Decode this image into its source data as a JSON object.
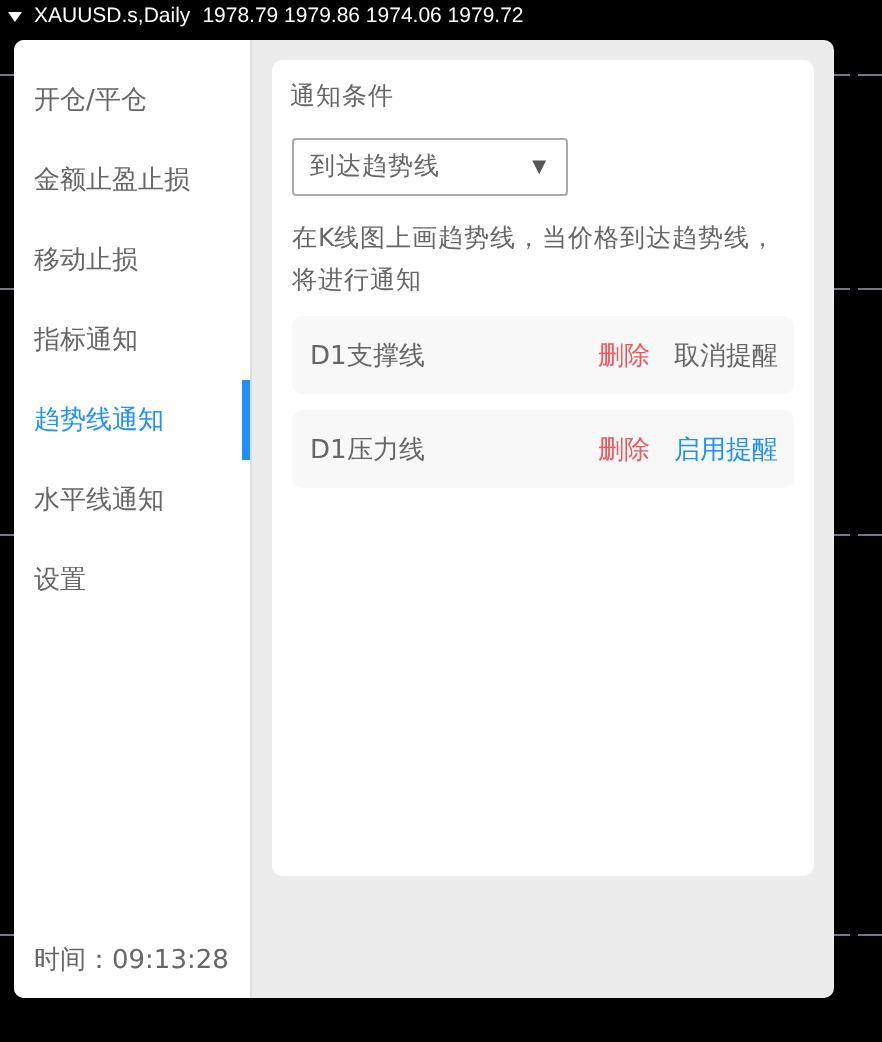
{
  "chart_header": {
    "label": "XAUUSD.s,Daily",
    "prices": "1978.79 1979.86 1974.06 1979.72"
  },
  "sidebar": {
    "items": [
      {
        "label": "开仓/平仓",
        "selected": false
      },
      {
        "label": "金额止盈止损",
        "selected": false
      },
      {
        "label": "移动止损",
        "selected": false
      },
      {
        "label": "指标通知",
        "selected": false
      },
      {
        "label": "趋势线通知",
        "selected": true
      },
      {
        "label": "水平线通知",
        "selected": false
      },
      {
        "label": "设置",
        "selected": false
      }
    ],
    "time": "时间：09:13:28"
  },
  "content": {
    "section_title": "通知条件",
    "dropdown": {
      "value": "到达趋势线",
      "caret": "▼"
    },
    "description": "在K线图上画趋势线，当价格到达趋势线，将进行通知",
    "lines": [
      {
        "name": "D1支撑线",
        "delete": "删除",
        "toggle": "取消提醒",
        "alert_on": true
      },
      {
        "name": "D1压力线",
        "delete": "删除",
        "toggle": "启用提醒",
        "alert_on": false
      }
    ]
  }
}
